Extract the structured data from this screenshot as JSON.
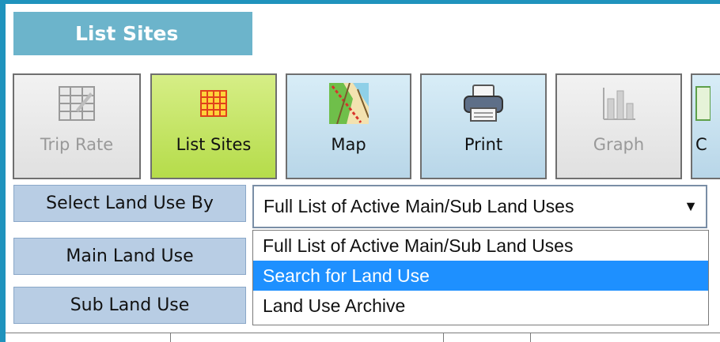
{
  "header": {
    "title": "List Sites"
  },
  "toolbar": {
    "trip_rate": {
      "label": "Trip Rate",
      "icon": "spreadsheet-icon",
      "state": "disabled"
    },
    "list_sites": {
      "label": "List Sites",
      "icon": "grid-list-icon",
      "state": "active"
    },
    "map": {
      "label": "Map",
      "icon": "map-icon",
      "state": "enabled"
    },
    "print": {
      "label": "Print",
      "icon": "printer-icon",
      "state": "enabled"
    },
    "graph": {
      "label": "Graph",
      "icon": "bar-chart-icon",
      "state": "disabled"
    },
    "partial_label": "C"
  },
  "filters": {
    "select_by_label": "Select Land Use By",
    "main_label": "Main Land Use",
    "sub_label": "Sub Land Use",
    "select_value": "Full List of Active Main/Sub Land Uses",
    "options": [
      "Full List of Active Main/Sub Land Uses",
      "Search for Land Use",
      "Land Use Archive"
    ],
    "highlighted_option": "Search for Land Use"
  },
  "colors": {
    "background": "#1f93bd",
    "title_bar": "#6cb4cb",
    "active_button": "#b5dc4a",
    "row_label": "#b8cde4",
    "option_highlight": "#1e90ff"
  }
}
